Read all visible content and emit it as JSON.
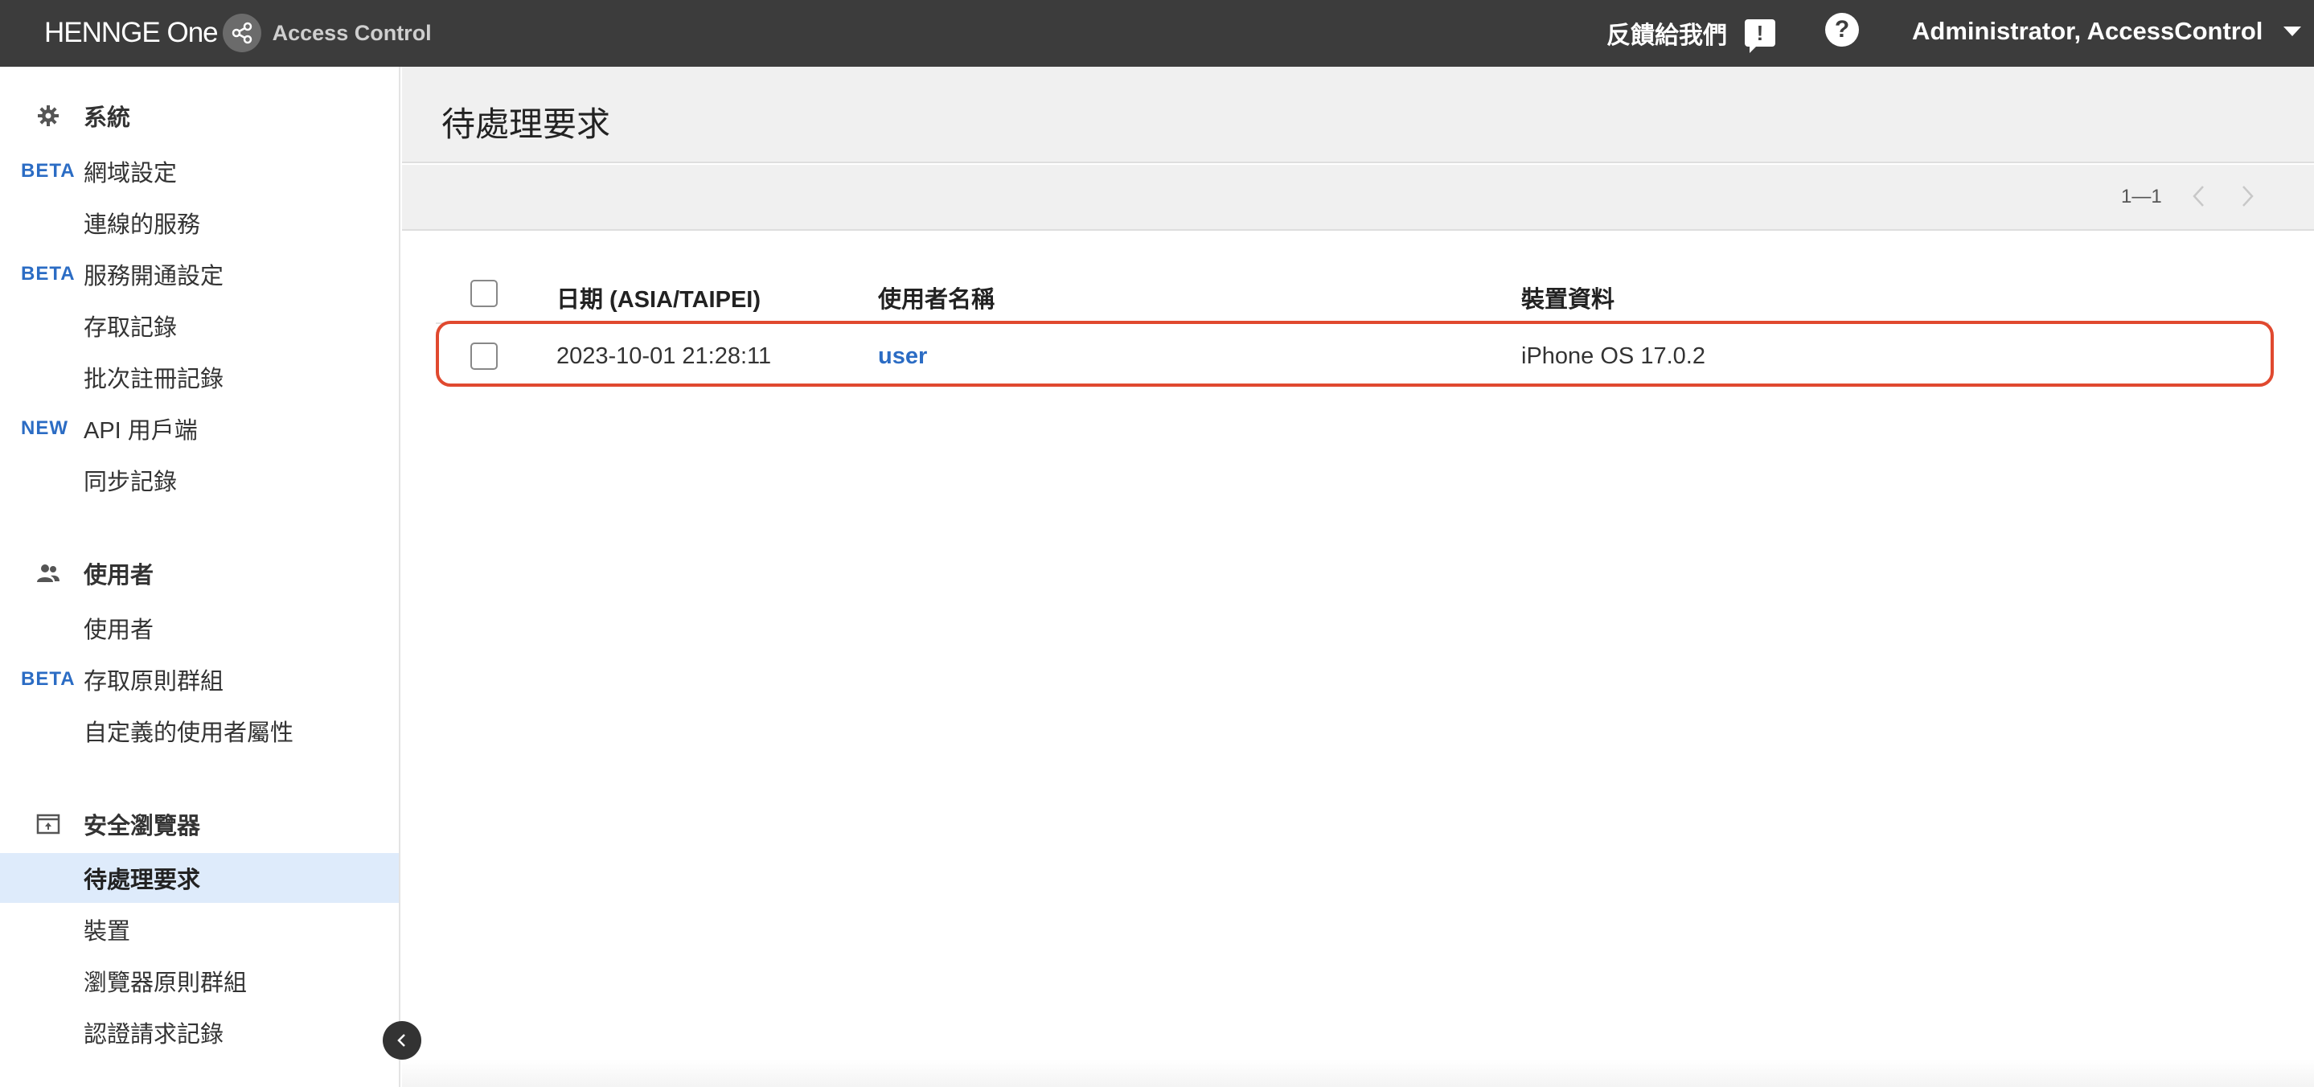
{
  "topbar": {
    "brand": "HENNGE One",
    "product": "Access Control",
    "feedback_label": "反饋給我們",
    "user_label": "Administrator, AccessControl"
  },
  "sidebar": {
    "sections": [
      {
        "title": "系統",
        "icon": "gear-icon",
        "items": [
          {
            "badge": "BETA",
            "label": "網域設定"
          },
          {
            "badge": "",
            "label": "連線的服務"
          },
          {
            "badge": "BETA",
            "label": "服務開通設定"
          },
          {
            "badge": "",
            "label": "存取記錄"
          },
          {
            "badge": "",
            "label": "批次註冊記錄"
          },
          {
            "badge": "NEW",
            "label": "API 用戶端"
          },
          {
            "badge": "",
            "label": "同步記錄"
          }
        ]
      },
      {
        "title": "使用者",
        "icon": "users-icon",
        "items": [
          {
            "badge": "",
            "label": "使用者"
          },
          {
            "badge": "BETA",
            "label": "存取原則群組"
          },
          {
            "badge": "",
            "label": "自定義的使用者屬性"
          }
        ]
      },
      {
        "title": "安全瀏覽器",
        "icon": "secure-browser-icon",
        "items": [
          {
            "badge": "",
            "label": "待處理要求",
            "active": true
          },
          {
            "badge": "",
            "label": "裝置"
          },
          {
            "badge": "",
            "label": "瀏覽器原則群組"
          },
          {
            "badge": "",
            "label": "認證請求記錄"
          }
        ]
      }
    ]
  },
  "main": {
    "title": "待處理要求",
    "pager": "1—1",
    "table": {
      "columns": [
        "日期 (ASIA/TAIPEI)",
        "使用者名稱",
        "裝置資料"
      ],
      "rows": [
        {
          "date": "2023-10-01 21:28:11",
          "user": "user",
          "device": "iPhone OS 17.0.2"
        }
      ]
    }
  },
  "colors": {
    "topbar": "#3c3c3c",
    "accent": "#2b6cc4",
    "active_bg": "#deebfb",
    "highlight_border": "#e0492f"
  }
}
